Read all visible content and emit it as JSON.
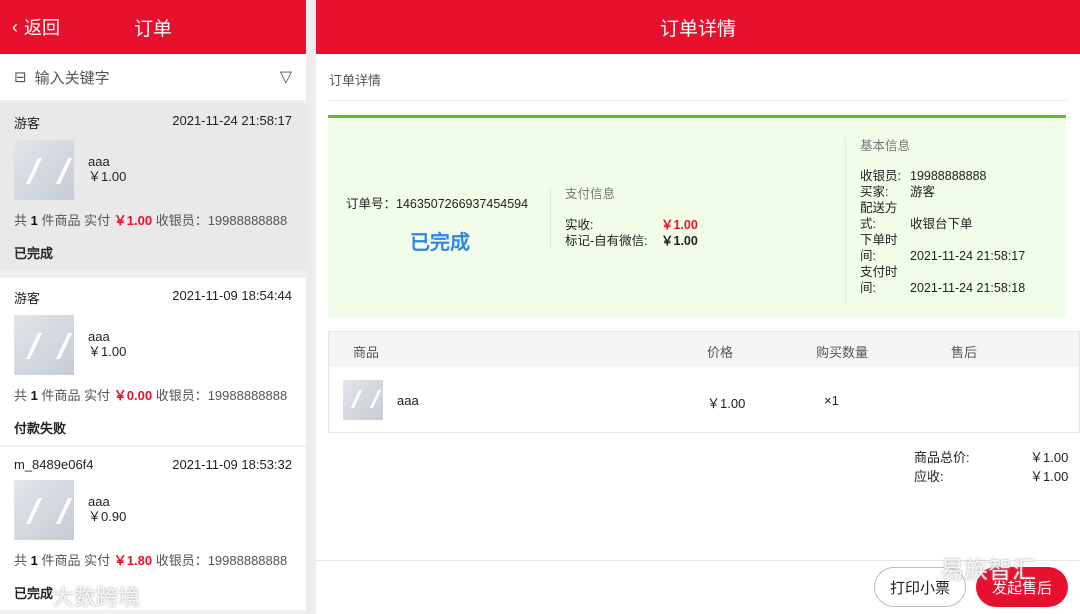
{
  "left_header": {
    "back": "返回",
    "title": "订单"
  },
  "right_header": {
    "title": "订单详情"
  },
  "search": {
    "placeholder": "输入关键字"
  },
  "orders": [
    {
      "buyer": "游客",
      "time": "2021-11-24 21:58:17",
      "product": "aaa",
      "price": "￥1.00",
      "count_prefix": "共",
      "count": "1",
      "count_suffix": "件商品 实付",
      "paid": "￥1.00",
      "cashier": "收银员：19988888888",
      "status": "已完成"
    },
    {
      "buyer": "游客",
      "time": "2021-11-09 18:54:44",
      "product": "aaa",
      "price": "￥1.00",
      "count_prefix": "共",
      "count": "1",
      "count_suffix": "件商品 实付",
      "paid": "￥0.00",
      "cashier": "收银员：19988888888",
      "status": "付款失败"
    },
    {
      "buyer": "m_8489e06f4",
      "time": "2021-11-09 18:53:32",
      "product": "aaa",
      "price": "￥0.90",
      "count_prefix": "共",
      "count": "1",
      "count_suffix": "件商品 实付",
      "paid": "￥1.80",
      "cashier": "收银员：19988888888",
      "status": "已完成"
    }
  ],
  "detail": {
    "section": "订单详情",
    "order_no": "订单号：1463507266937454594",
    "status": "已完成",
    "pay": {
      "title": "支付信息",
      "rows": [
        {
          "k": "实收:",
          "v": "￥1.00"
        },
        {
          "k": "标记-自有微信:",
          "v": "￥1.00"
        }
      ]
    },
    "basic": {
      "title": "基本信息",
      "rows": [
        {
          "k": "收银员:",
          "v": "19988888888"
        },
        {
          "k": "买家:",
          "v": "游客"
        },
        {
          "k": "配送方式:",
          "v": "收银台下单"
        },
        {
          "k": "下单时间:",
          "v": "2021-11-24 21:58:17"
        },
        {
          "k": "支付时间:",
          "v": "2021-11-24 21:58:18"
        }
      ]
    },
    "table": {
      "headers": [
        "商品",
        "价格",
        "购买数量",
        "售后"
      ],
      "rows": [
        {
          "name": "aaa",
          "price": "￥1.00",
          "qty": "×1"
        }
      ]
    },
    "totals": [
      {
        "k": "商品总价:",
        "v": "￥1.00"
      },
      {
        "k": "应收:",
        "v": "￥1.00"
      }
    ],
    "print": "打印小票",
    "aftersale": "发起售后"
  },
  "watermarks": [
    "大数跨境",
    "易族智汇"
  ],
  "colors": {
    "brand": "#e8112d",
    "success_green": "#5dbb2e",
    "status_blue": "#2f86e6"
  }
}
